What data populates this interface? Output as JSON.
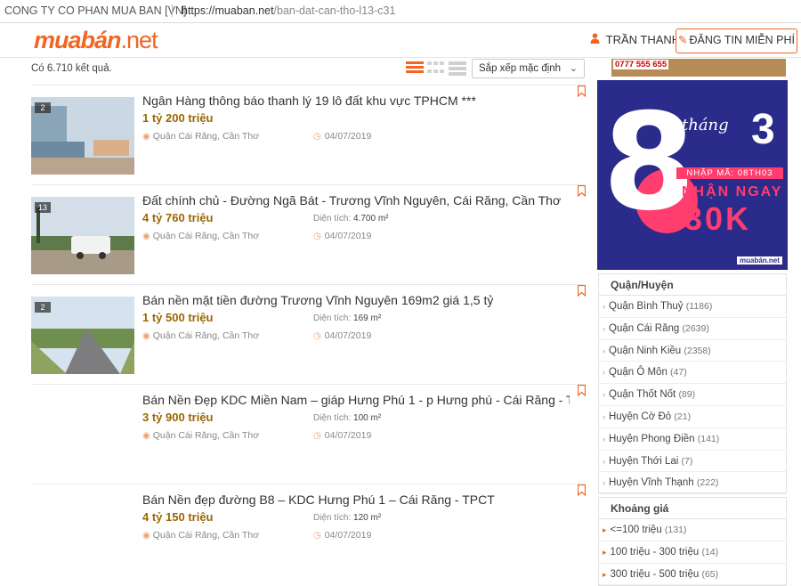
{
  "browser": {
    "site_identity": "CONG TY CO PHAN MUA BAN [VN]",
    "url_host": "https://muaban.net",
    "url_path": "/ban-dat-can-tho-l13-c31"
  },
  "header": {
    "logo_brand": "muabán",
    "logo_tld": ".net",
    "user_name": "TRẦN THANH",
    "post_button": "ĐĂNG TIN MIỄN PHÍ"
  },
  "toolbar": {
    "result_count": "Có 6.710 kết quả.",
    "sort_label": "Sắp xếp mặc định"
  },
  "listings": [
    {
      "title": "Ngân Hàng thông báo thanh lý 19 lô đất khu vực TPHCM ***",
      "price": "1 tỷ 200 triệu",
      "area_label": "",
      "area_value": "",
      "location": "Quận Cái Răng, Cần Thơ",
      "date": "04/07/2019",
      "photo_count": "2"
    },
    {
      "title": "Đất chính chủ - Đường Ngã Bát - Trương Vĩnh Nguyên, Cái Răng, Cần Thơ",
      "price": "4 tỷ 760 triệu",
      "area_label": "Diện tích:",
      "area_value": "4.700 m²",
      "location": "Quận Cái Răng, Cần Thơ",
      "date": "04/07/2019",
      "photo_count": "13"
    },
    {
      "title": "Bán nền mặt tiền đường Trương Vĩnh Nguyên 169m2 giá 1,5 tỷ",
      "price": "1 tỷ 500 triệu",
      "area_label": "Diện tích:",
      "area_value": "169 m²",
      "location": "Quận Cái Răng, Cần Thơ",
      "date": "04/07/2019",
      "photo_count": "2"
    },
    {
      "title": "Bán Nền Đẹp KDC Miền Nam – giáp Hưng Phú 1 - p Hưng phú - Cái Răng - T",
      "price": "3 tỷ 900 triệu",
      "area_label": "Diện tích:",
      "area_value": "100 m²",
      "location": "Quận Cái Răng, Cần Thơ",
      "date": "04/07/2019",
      "photo_count": ""
    },
    {
      "title": "Bán Nền đẹp đường B8 – KDC Hưng Phú 1 – Cái Răng - TPCT",
      "price": "4 tỷ 150 triệu",
      "area_label": "Diện tích:",
      "area_value": "120 m²",
      "location": "Quận Cái Răng, Cần Thơ",
      "date": "04/07/2019",
      "photo_count": ""
    }
  ],
  "banner_top": {
    "phone": "0777 555 655"
  },
  "promo": {
    "big_number": "8",
    "month_word": "tháng",
    "month_number": "3",
    "code": "NHẬP MÃ: 08TH03",
    "headline": "NHẬN NGAY",
    "amount": "30K",
    "logo": "muabán.net"
  },
  "districts": {
    "title": "Quận/Huyện",
    "items": [
      {
        "name": "Quận Bình Thuỷ",
        "count": "(1186)"
      },
      {
        "name": "Quận Cái Răng",
        "count": "(2639)"
      },
      {
        "name": "Quận Ninh Kiều",
        "count": "(2358)"
      },
      {
        "name": "Quận Ô Môn",
        "count": "(47)"
      },
      {
        "name": "Quận Thốt Nốt",
        "count": "(89)"
      },
      {
        "name": "Huyện Cờ Đỏ",
        "count": "(21)"
      },
      {
        "name": "Huyện Phong Điền",
        "count": "(141)"
      },
      {
        "name": "Huyện Thới Lai",
        "count": "(7)"
      },
      {
        "name": "Huyện Vĩnh Thạnh",
        "count": "(222)"
      }
    ]
  },
  "price_ranges": {
    "title": "Khoảng giá",
    "items": [
      {
        "name": "<=100 triệu",
        "count": "(131)"
      },
      {
        "name": "100 triệu - 300 triệu",
        "count": "(14)"
      },
      {
        "name": "300 triệu - 500 triệu",
        "count": "(65)"
      }
    ]
  },
  "colors": {
    "brand": "#f26522",
    "price": "#9a6600",
    "promo_bg": "#2a2b8a",
    "promo_accent": "#ff3d6e"
  }
}
